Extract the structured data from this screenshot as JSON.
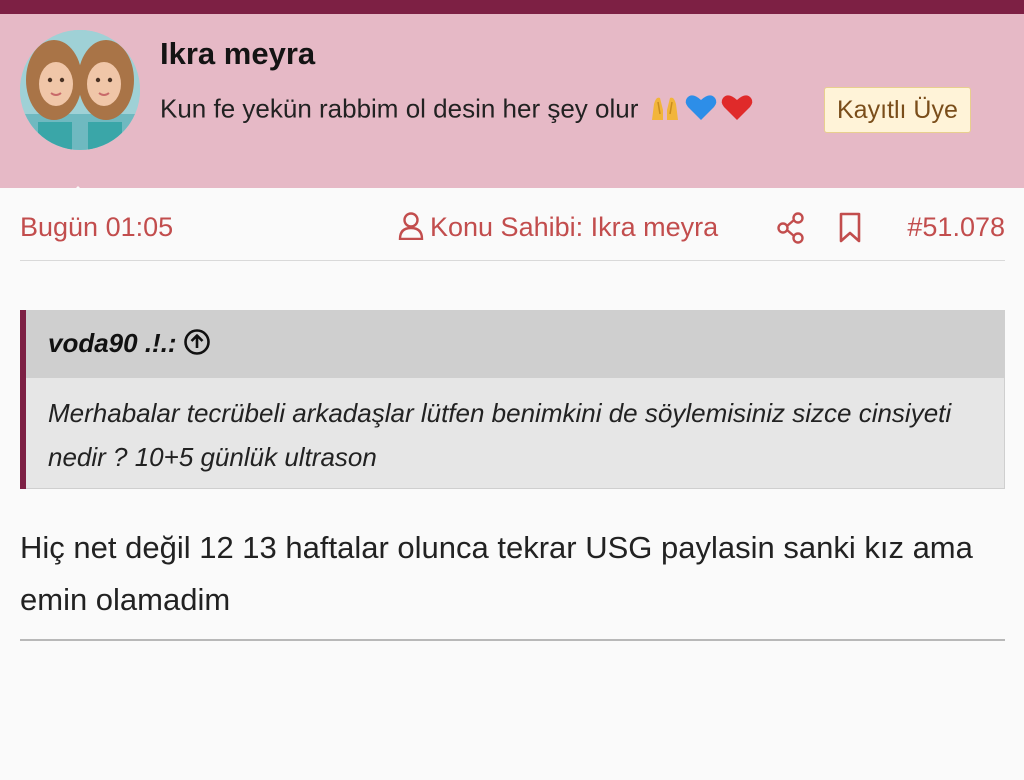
{
  "header": {
    "username": "Ikra meyra",
    "bio_text": "Kun fe yekün rabbim ol desin her şey olur",
    "emojis": [
      "praying-hands",
      "blue-heart",
      "red-heart"
    ],
    "badge": "Kayıtlı Üye"
  },
  "meta": {
    "time": "Bugün 01:05",
    "owner": "Konu Sahibi: Ikra meyra",
    "post_number": "#51.078"
  },
  "quote": {
    "author": "voda90 .!.:",
    "text": "Merhabalar tecrübeli arkadaşlar lütfen benimkini de söylemisiniz sizce cinsiyeti nedir ? 10+5 günlük ultrason"
  },
  "post": {
    "body": "Hiç net değil 12 13 haftalar olunca tekrar USG paylasin sanki kız ama emin olamadim"
  },
  "colors": {
    "accent": "#7d2044",
    "header_bg": "#e6b9c6",
    "meta_text": "#c24d4d",
    "badge_bg": "#fff3d8"
  }
}
